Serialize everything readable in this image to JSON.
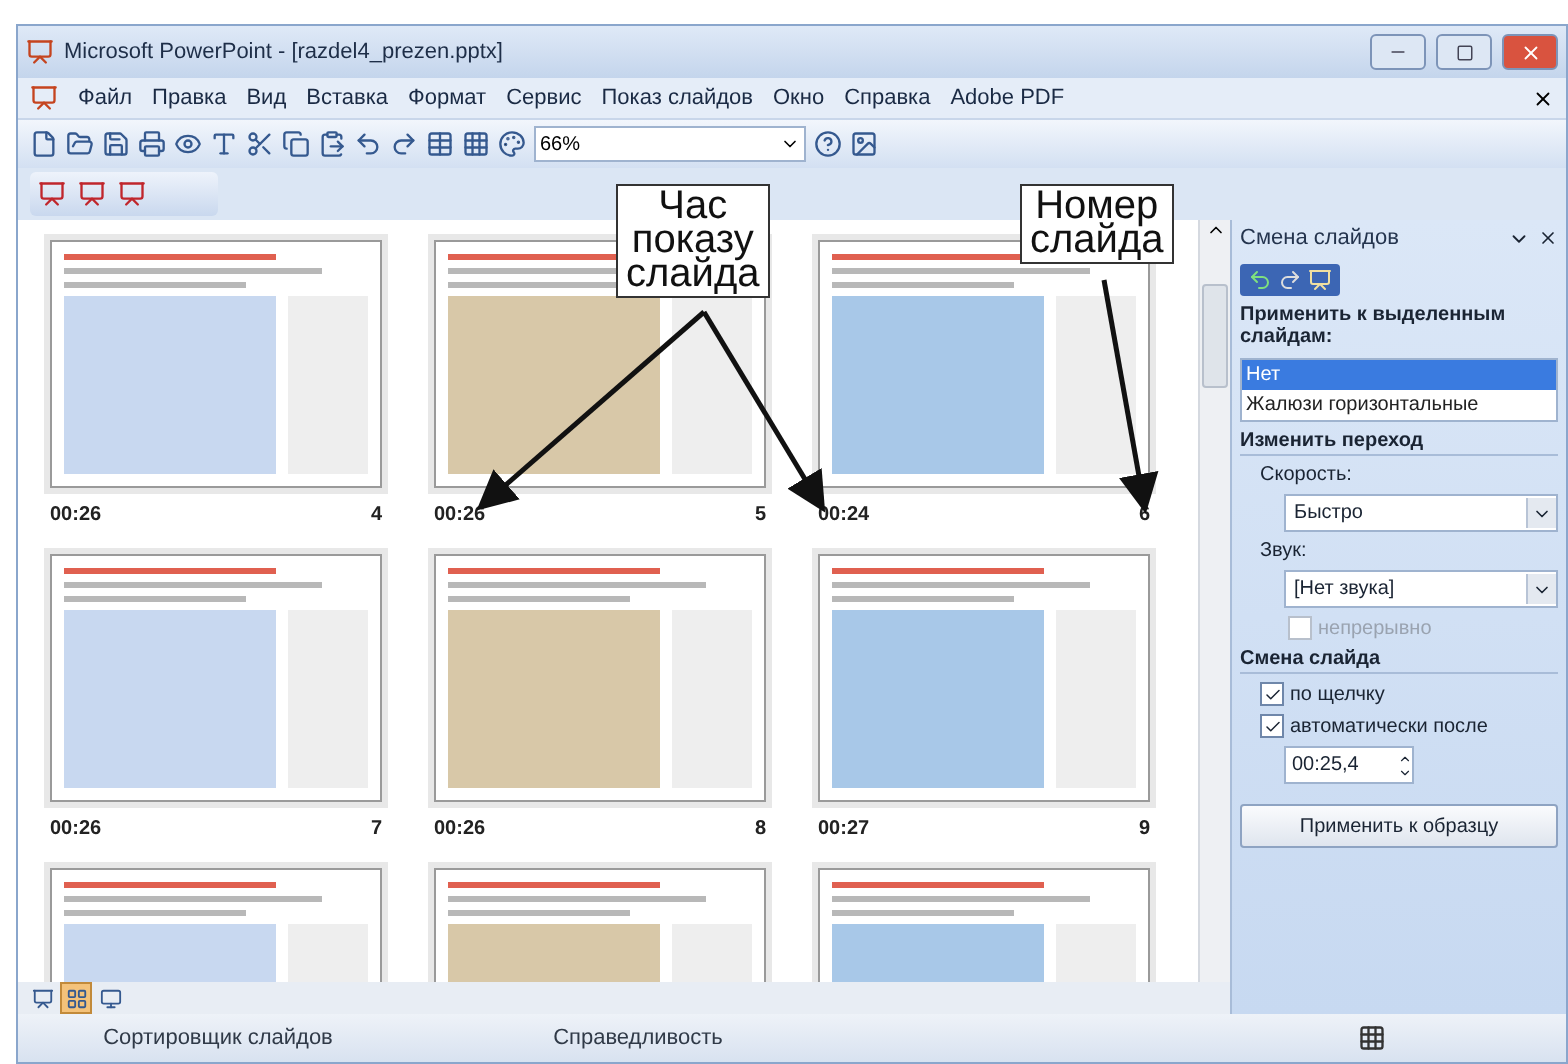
{
  "window": {
    "title": "Microsoft PowerPoint - [razdel4_prezen.pptx]"
  },
  "menu": [
    "Файл",
    "Правка",
    "Вид",
    "Вставка",
    "Формат",
    "Сервис",
    "Показ слайдов",
    "Окно",
    "Справка",
    "Adobe PDF"
  ],
  "toolbar": {
    "zoom": "66%"
  },
  "slides": [
    {
      "kind": "full",
      "time": "00:26",
      "number": "4"
    },
    {
      "kind": "full",
      "time": "00:26",
      "number": "5"
    },
    {
      "kind": "full",
      "time": "00:24",
      "number": "6"
    },
    {
      "kind": "full",
      "time": "00:26",
      "number": "7"
    },
    {
      "kind": "full",
      "time": "00:26",
      "number": "8"
    },
    {
      "kind": "full",
      "time": "00:27",
      "number": "9"
    },
    {
      "kind": "partial"
    },
    {
      "kind": "partial"
    },
    {
      "kind": "partial"
    }
  ],
  "callouts": [
    {
      "kind": "time",
      "text": "Час\nпоказу\nслайда"
    },
    {
      "kind": "number",
      "text": "Номер\nслайда"
    }
  ],
  "task_pane": {
    "title": "Смена слайдов",
    "apply_label": "Применить к выделенным слайдам:",
    "transitions": [
      {
        "label": "Нет",
        "selected": true
      },
      {
        "label": "Жалюзи горизонтальные",
        "selected": false
      }
    ],
    "modify_heading": "Изменить переход",
    "speed_label": "Скорость:",
    "speed_value": "Быстро",
    "sound_label": "Звук:",
    "sound_value": "[Нет звука]",
    "loop": {
      "label": "непрерывно",
      "checked": false,
      "disabled": true
    },
    "advance_heading": "Смена слайда",
    "on_click": {
      "label": "по щелчку",
      "checked": true
    },
    "automatic": {
      "label": "автоматически после",
      "checked": true
    },
    "time": "00:25,4",
    "apply_button": "Применить к образцу"
  },
  "view_buttons": [
    {
      "kind": "normal",
      "selected": false
    },
    {
      "kind": "sorter",
      "selected": true
    },
    {
      "kind": "show",
      "selected": false
    }
  ],
  "status_bar": [
    "Сортировщик слайдов",
    "Справедливость"
  ]
}
